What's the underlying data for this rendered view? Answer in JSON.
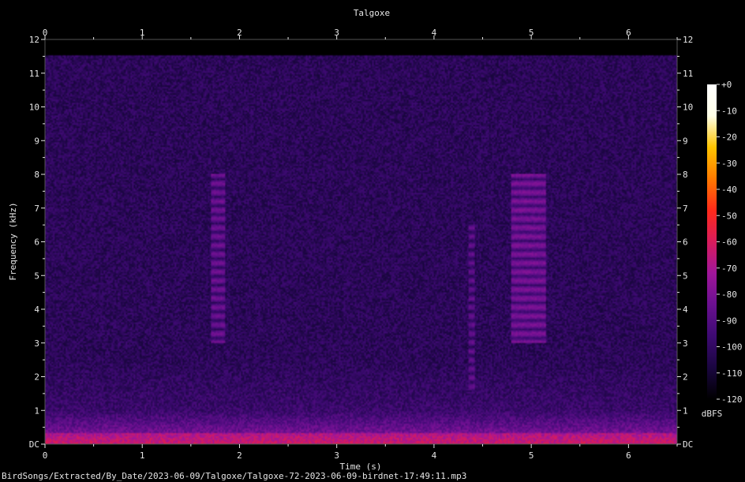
{
  "chart_data": {
    "type": "heatmap",
    "title": "Talgoxe",
    "xlabel": "Time (s)",
    "ylabel": "Frequency (kHz)",
    "xlim": [
      0,
      6.5
    ],
    "ylim": [
      0,
      12
    ],
    "x_ticks": [
      "0",
      "1",
      "2",
      "3",
      "4",
      "5",
      "6"
    ],
    "y_ticks": [
      "DC",
      "1",
      "2",
      "3",
      "4",
      "5",
      "6",
      "7",
      "8",
      "9",
      "10",
      "11",
      "12"
    ],
    "colorbar": {
      "label": "dBFS",
      "range": [
        -120,
        0
      ],
      "ticks": [
        "+0",
        "-10",
        "-20",
        "-30",
        "-40",
        "-50",
        "-60",
        "-70",
        "-80",
        "-90",
        "-100",
        "-110",
        "-120"
      ],
      "colors": [
        "#000000",
        "#1a0640",
        "#3d0a72",
        "#6a1090",
        "#a0169a",
        "#d81c5c",
        "#ff2a1a",
        "#ff7a00",
        "#ffc400",
        "#ffffe8",
        "#ffffff"
      ]
    },
    "events": [
      {
        "t_start": 1.7,
        "t_end": 1.85,
        "f_low": 3.0,
        "f_high": 8.0,
        "level_dbfs": -85
      },
      {
        "t_start": 4.35,
        "t_end": 4.42,
        "f_low": 1.5,
        "f_high": 6.5,
        "level_dbfs": -90
      },
      {
        "t_start": 4.8,
        "t_end": 5.15,
        "f_low": 3.0,
        "f_high": 8.0,
        "level_dbfs": -80
      }
    ],
    "grid": false
  },
  "footer": {
    "path": "BirdSongs/Extracted/By_Date/2023-06-09/Talgoxe/Talgoxe-72-2023-06-09-birdnet-17:49:11.mp3"
  }
}
